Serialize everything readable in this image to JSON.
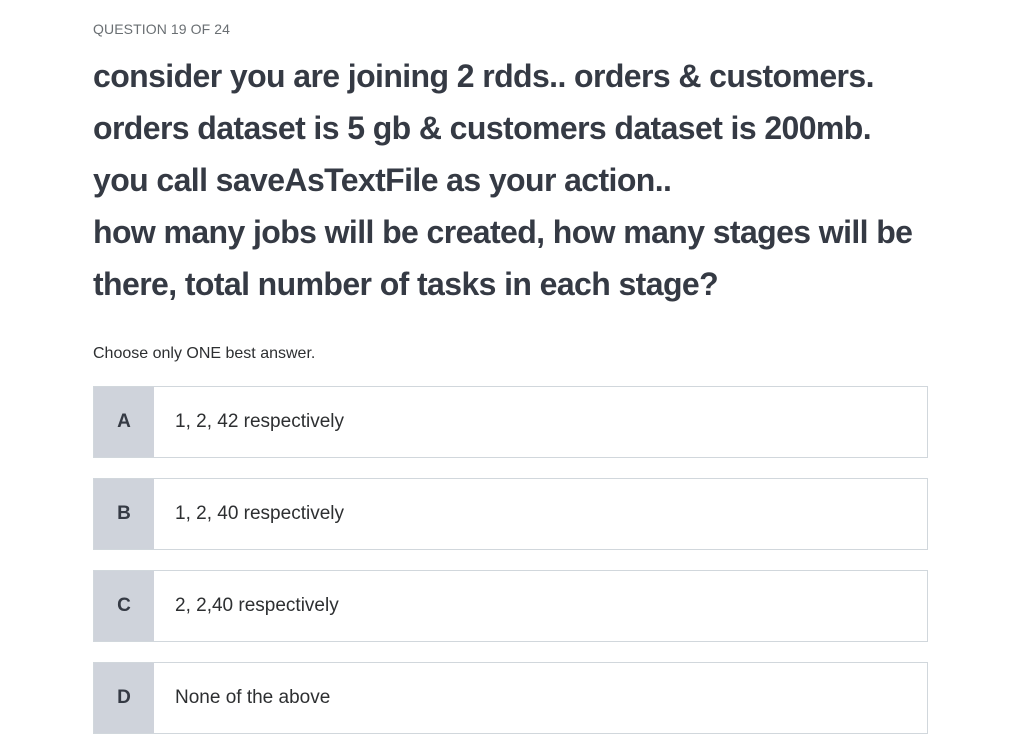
{
  "progress": "QUESTION 19 OF 24",
  "question": {
    "lines": [
      "consider you are joining 2 rdds.. orders & customers.",
      "orders dataset is 5 gb & customers dataset is 200mb.",
      "you call saveAsTextFile as your action..",
      "how many jobs will be created, how many stages will be",
      "there, total number of tasks in each stage?"
    ]
  },
  "instruction": "Choose only ONE best answer.",
  "options": [
    {
      "letter": "A",
      "text": "1, 2, 42 respectively"
    },
    {
      "letter": "B",
      "text": "1, 2, 40 respectively"
    },
    {
      "letter": "C",
      "text": "2, 2,40 respectively"
    },
    {
      "letter": "D",
      "text": "None of the above"
    }
  ]
}
